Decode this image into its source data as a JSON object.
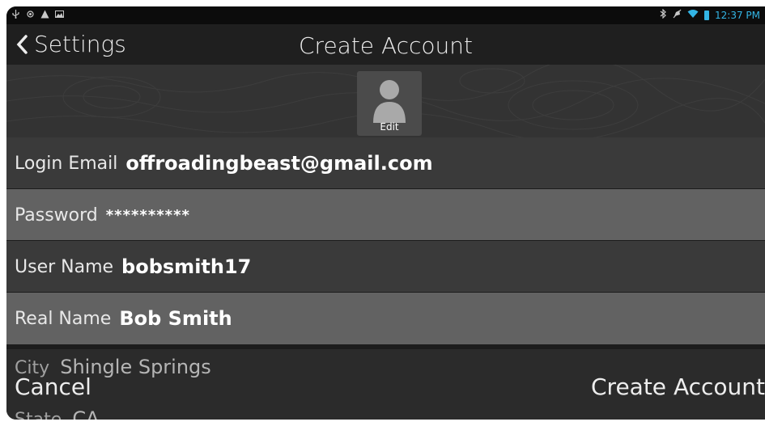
{
  "status_bar": {
    "icons_left": [
      "usb-icon",
      "gps-icon",
      "warning-icon",
      "image-icon"
    ],
    "icons_right": [
      "bluetooth-icon",
      "mute-icon",
      "wifi-icon",
      "battery-icon"
    ],
    "time": "12:37 PM",
    "accent": "#33b5e5"
  },
  "nav": {
    "back_label": "Settings",
    "title": "Create Account"
  },
  "avatar": {
    "edit_label": "Edit"
  },
  "fields": [
    {
      "label": "Login Email",
      "value": "offroadingbeast@gmail.com"
    },
    {
      "label": "Password",
      "value": "**********"
    },
    {
      "label": "User Name",
      "value": "bobsmith17"
    },
    {
      "label": "Real Name",
      "value": "Bob Smith"
    },
    {
      "label": "City",
      "value": "Shingle Springs"
    },
    {
      "label": "State",
      "value": "CA"
    }
  ],
  "actions": {
    "cancel_label": "Cancel",
    "create_label": "Create Account"
  }
}
